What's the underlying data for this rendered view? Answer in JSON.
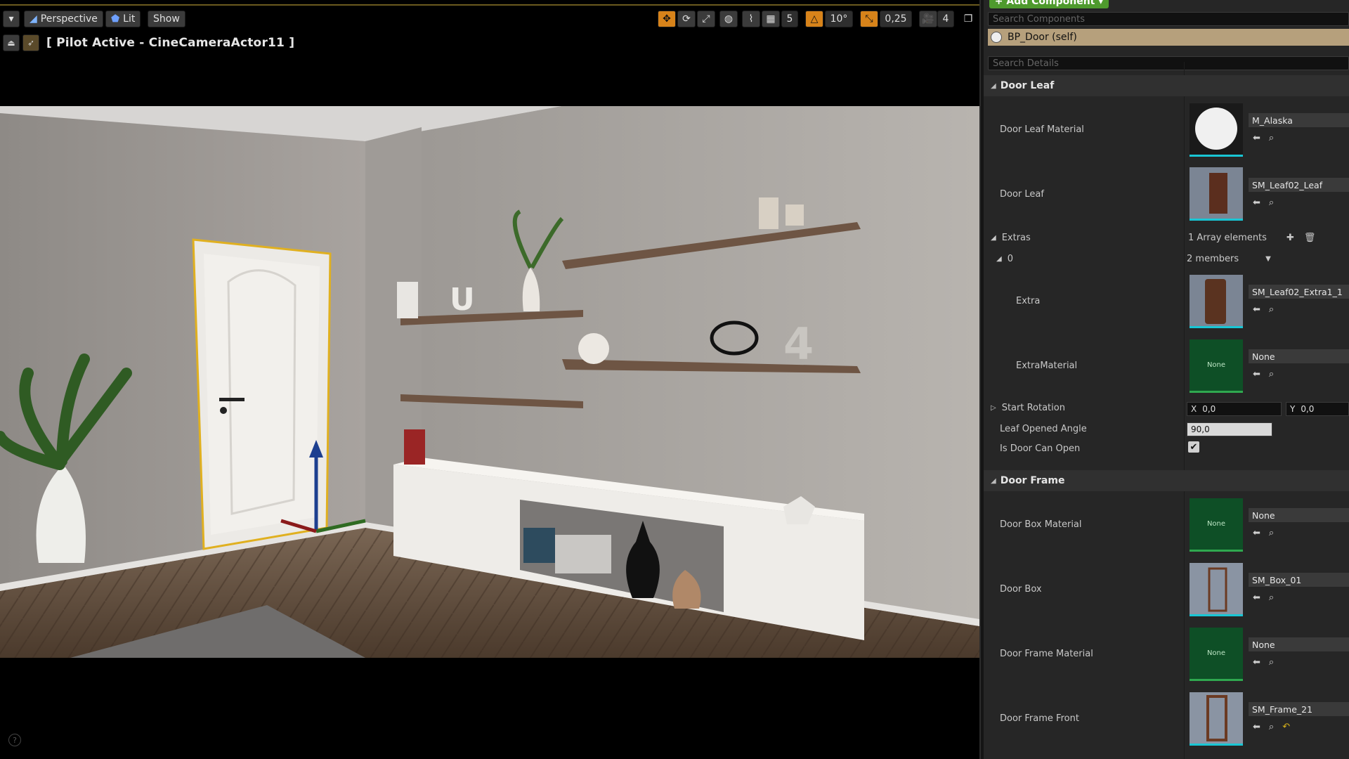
{
  "viewport": {
    "toolbar": {
      "menu_label": "▾",
      "perspective_label": "Perspective",
      "lit_label": "Lit",
      "show_label": "Show",
      "grid_snap": "5",
      "rotation_snap": "10°",
      "scale_snap": "0,25",
      "camera_speed": "4"
    },
    "pilot_label": "[ Pilot Active - CineCameraActor11 ]",
    "help": "?"
  },
  "details": {
    "add_component_label": "+ Add Component ▾",
    "search_components_placeholder": "Search Components",
    "self_label": "BP_Door (self)",
    "search_details_placeholder": "Search Details",
    "sections": {
      "door_leaf": {
        "title": "Door Leaf",
        "leaf_material_label": "Door Leaf Material",
        "leaf_material_value": "M_Alaska",
        "leaf_label": "Door Leaf",
        "leaf_value": "SM_Leaf02_Leaf",
        "extras_label": "Extras",
        "extras_count": "1 Array elements",
        "extras_index": "0",
        "extras_members": "2 members",
        "extra_label": "Extra",
        "extra_value": "SM_Leaf02_Extra1_1",
        "extra_material_label": "ExtraMaterial",
        "extra_material_value": "None",
        "none_thumb": "None",
        "start_rotation_label": "Start Rotation",
        "start_rotation_x": "0,0",
        "start_rotation_y": "0,0",
        "x_label": "X",
        "y_label": "Y",
        "opened_angle_label": "Leaf Opened Angle",
        "opened_angle_value": "90,0",
        "can_open_label": "Is Door Can Open",
        "can_open": true
      },
      "door_frame": {
        "title": "Door Frame",
        "box_material_label": "Door Box Material",
        "box_material_value": "None",
        "box_label": "Door Box",
        "box_value": "SM_Box_01",
        "frame_material_label": "Door Frame Material",
        "frame_material_value": "None",
        "frame_front_label": "Door Frame Front",
        "frame_front_value": "SM_Frame_21"
      }
    }
  },
  "colors": {
    "accent": "#e08a1b",
    "selected_row": "#b6a07c",
    "add_button": "#4e9a2d",
    "thumb_underline": "#19c6d4",
    "none_thumb": "#0e4f26"
  }
}
